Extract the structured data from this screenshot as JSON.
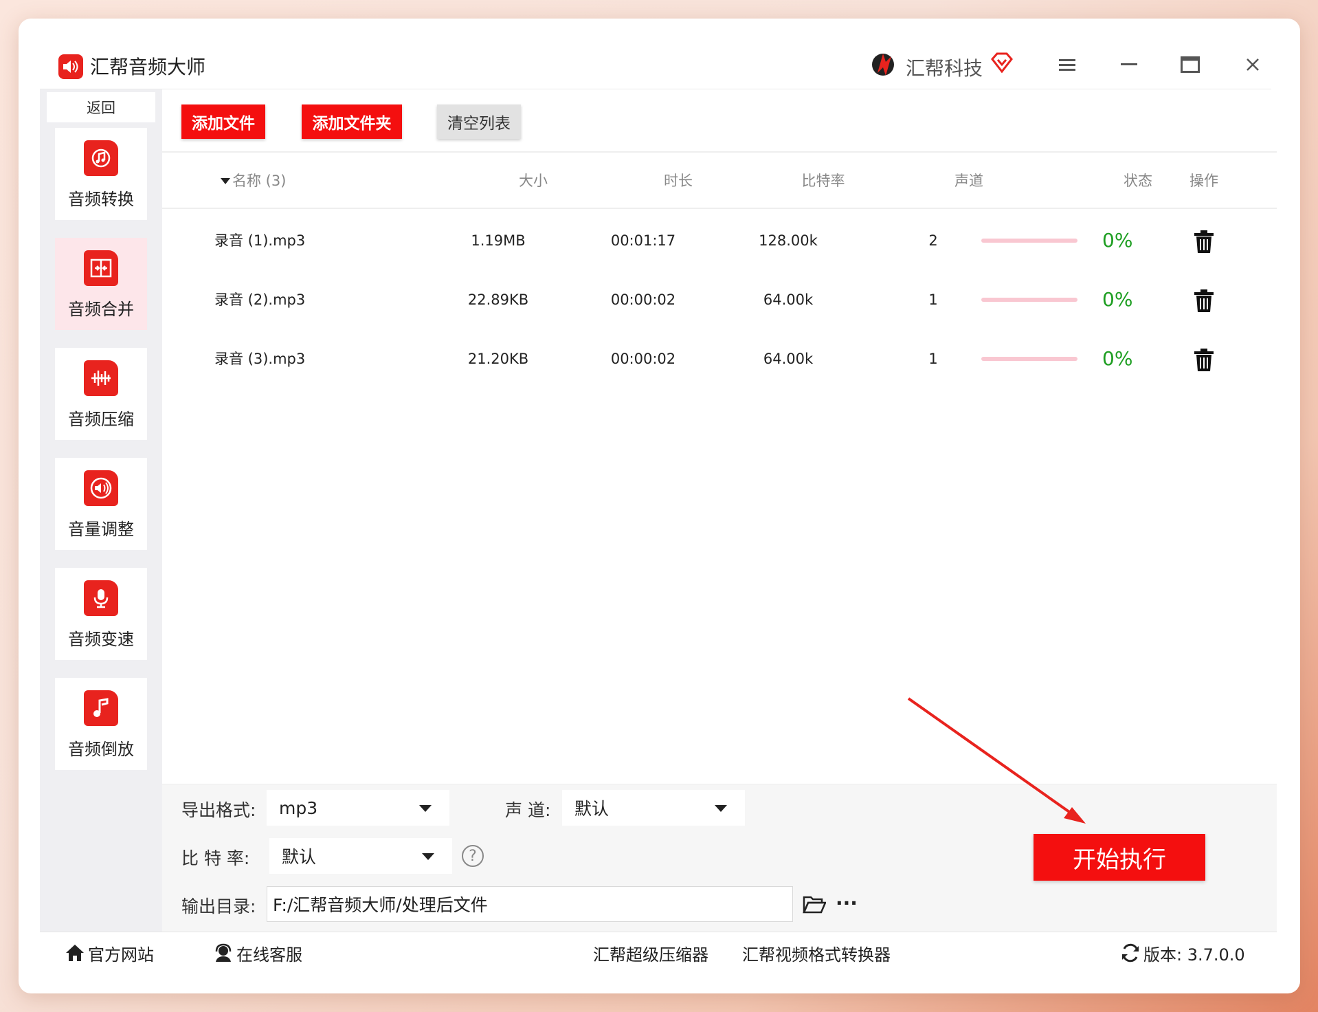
{
  "app": {
    "title": "汇帮音频大师",
    "brand_name": "汇帮科技"
  },
  "colors": {
    "accent": "#f40f0f",
    "active_bg": "#fde6ea",
    "progress_track": "#f9c7d1",
    "percent_text": "#1e9e22"
  },
  "sidebar": {
    "back_label": "返回",
    "items": [
      {
        "label": "音频转换",
        "icon": "audio-convert-icon"
      },
      {
        "label": "音频合并",
        "icon": "audio-merge-icon",
        "active": true
      },
      {
        "label": "音频压缩",
        "icon": "audio-compress-icon"
      },
      {
        "label": "音量调整",
        "icon": "volume-adjust-icon"
      },
      {
        "label": "音频变速",
        "icon": "audio-speed-icon"
      },
      {
        "label": "音频倒放",
        "icon": "audio-reverse-icon"
      }
    ]
  },
  "toolbar": {
    "add_file": "添加文件",
    "add_folder": "添加文件夹",
    "clear_list": "清空列表"
  },
  "table": {
    "columns": {
      "name": "名称 (3)",
      "size": "大小",
      "duration": "时长",
      "bitrate": "比特率",
      "channels": "声道",
      "status": "状态",
      "action": "操作"
    },
    "rows": [
      {
        "name": "录音 (1).mp3",
        "size": "1.19MB",
        "duration": "00:01:17",
        "bitrate": "128.00k",
        "channels": "2",
        "progress": "0%"
      },
      {
        "name": "录音 (2).mp3",
        "size": "22.89KB",
        "duration": "00:00:02",
        "bitrate": "64.00k",
        "channels": "1",
        "progress": "0%"
      },
      {
        "name": "录音 (3).mp3",
        "size": "21.20KB",
        "duration": "00:00:02",
        "bitrate": "64.00k",
        "channels": "1",
        "progress": "0%"
      }
    ]
  },
  "settings": {
    "format_label": "导出格式:",
    "format_value": "mp3",
    "channel_label": "声 道:",
    "channel_value": "默认",
    "bitrate_label": "比 特 率:",
    "bitrate_value": "默认",
    "help_symbol": "?",
    "output_label": "输出目录:",
    "output_value": "F:/汇帮音频大师/处理后文件",
    "more_symbol": "···"
  },
  "start_button": "开始执行",
  "footer": {
    "website": "官方网站",
    "support": "在线客服",
    "link1": "汇帮超级压缩器",
    "link2": "汇帮视频格式转换器",
    "version": "版本:  3.7.0.0"
  }
}
